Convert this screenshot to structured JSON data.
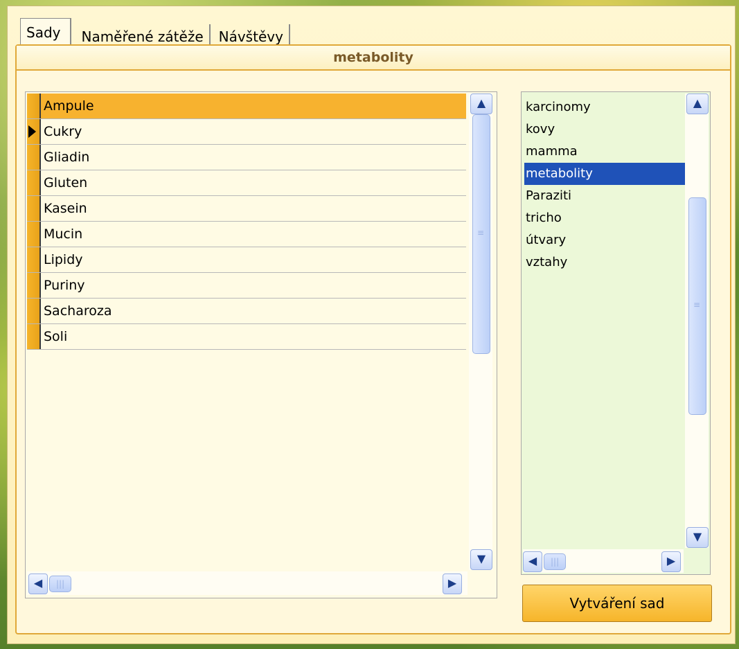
{
  "tabs": [
    {
      "label": "Sady"
    },
    {
      "label": "Naměřené zátěže"
    },
    {
      "label": "Návštěvy"
    }
  ],
  "panel": {
    "title": "metabolity"
  },
  "grid": {
    "rows": [
      "Ampule",
      "Cukry",
      "Gliadin",
      "Gluten",
      "Kasein",
      "Mucin",
      "Lipidy",
      "Puriny",
      "Sacharoza",
      "Soli"
    ],
    "selected_index": 0,
    "current_index": 1
  },
  "sets_list": {
    "items": [
      "karcinomy",
      "kovy",
      "mamma",
      "metabolity",
      "Paraziti",
      "tricho",
      "útvary",
      "vztahy"
    ],
    "selected_index": 3
  },
  "buttons": {
    "create_sets": "Vytváření sad"
  },
  "colors": {
    "accent_orange": "#f7b22f",
    "list_bg_green": "#ecf8d8",
    "selection_blue": "#1f52b8",
    "panel_bg": "#fff8dc"
  },
  "icons": {
    "scroll_up": "▲",
    "scroll_down": "▼",
    "scroll_left": "◀",
    "scroll_right": "▶"
  }
}
